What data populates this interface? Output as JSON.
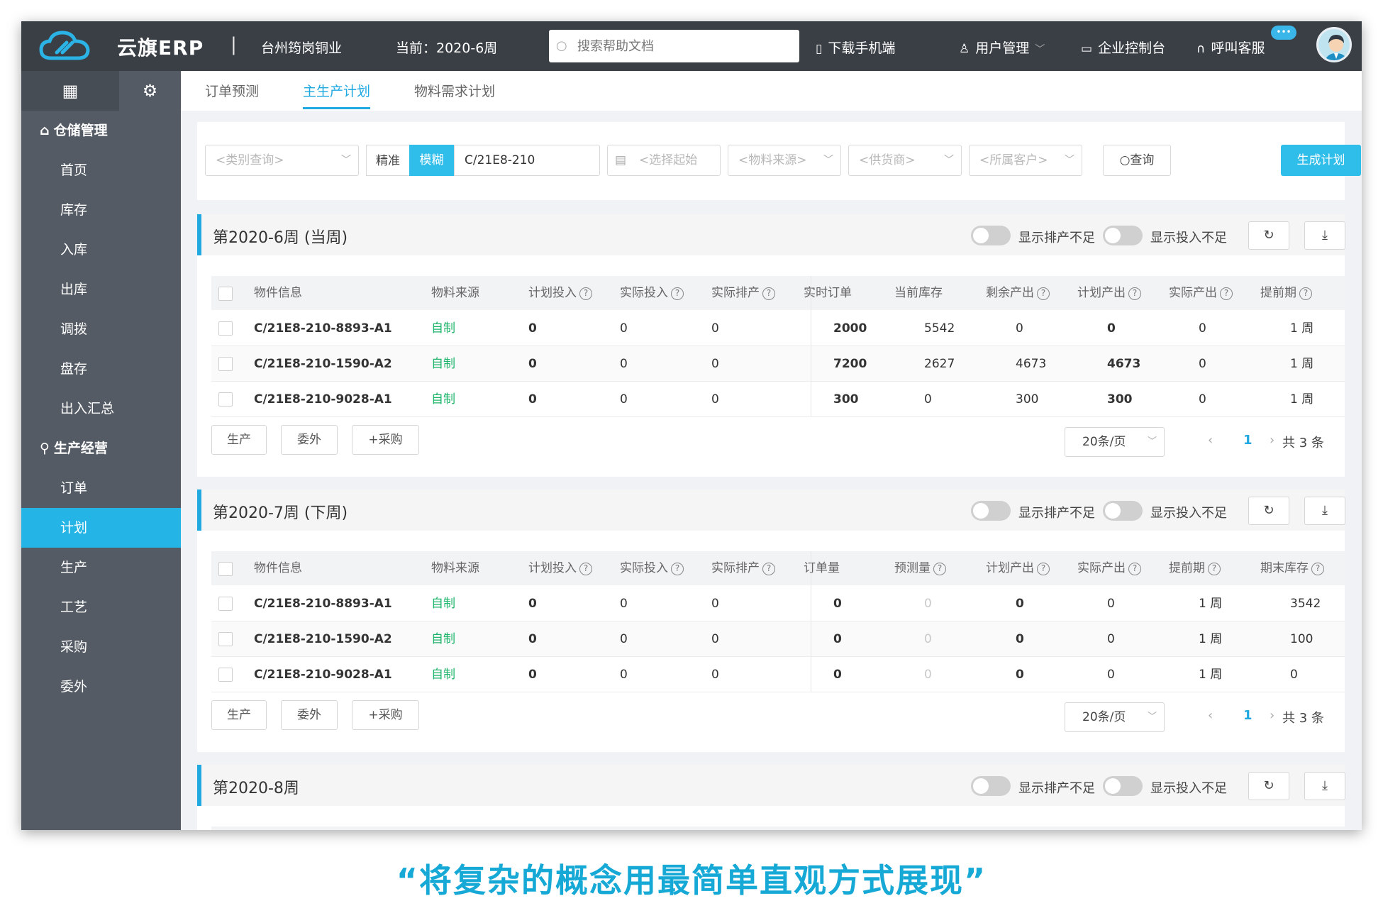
{
  "app": {
    "brand": "云旗ERP",
    "separator": "|",
    "company": "台州筠岗铜业",
    "current_period": "当前：2020-6周"
  },
  "search": {
    "placeholder": "搜索帮助文档"
  },
  "topnav": {
    "download": "下载手机端",
    "user_mgmt": "用户管理",
    "console": "企业控制台",
    "service": "呼叫客服",
    "bubble": "•••"
  },
  "sidebar": {
    "groups": [
      {
        "title": "仓储管理",
        "items": [
          "首页",
          "库存",
          "入库",
          "出库",
          "调拨",
          "盘存",
          "出入汇总"
        ]
      },
      {
        "title": "生产经营",
        "items": [
          "订单",
          "计划",
          "生产",
          "工艺",
          "采购",
          "委外"
        ]
      }
    ],
    "active": "计划"
  },
  "tabs": [
    {
      "label": "订单预测"
    },
    {
      "label": "主生产计划",
      "active": true
    },
    {
      "label": "物料需求计划"
    }
  ],
  "refresh_label": "刷新",
  "filter": {
    "category_placeholder": "<类别查询>",
    "exact_label": "精准",
    "fuzzy_label": "模糊",
    "keyword": "C/21E8-210",
    "start_placeholder": "<选择起始",
    "source_placeholder": "<物料来源>",
    "supplier_placeholder": "<供货商>",
    "customer_placeholder": "<所属客户>",
    "query_label": "查询",
    "generate_label": "生成计划"
  },
  "toggles": {
    "shortage_production": "显示排产不足",
    "shortage_input": "显示投入不足"
  },
  "actions": {
    "produce": "生产",
    "outsource": "委外",
    "purchase": "+采购"
  },
  "pagination": {
    "page_size": "20条/页",
    "current_page": "1",
    "total": "共 3 条"
  },
  "weeks": [
    {
      "title": "第2020-6周 (当周)",
      "columns": [
        "物件信息",
        "物料来源",
        "计划投入",
        "实际投入",
        "实际排产",
        "实时订单",
        "当前库存",
        "剩余产出",
        "计划产出",
        "实际产出",
        "提前期"
      ],
      "rows": [
        [
          "C/21E8-210-8893-A1",
          "自制",
          "0",
          "0",
          "0",
          "2000",
          "5542",
          "0",
          "0",
          "0",
          "1 周"
        ],
        [
          "C/21E8-210-1590-A2",
          "自制",
          "0",
          "0",
          "0",
          "7200",
          "2627",
          "4673",
          "4673",
          "0",
          "1 周"
        ],
        [
          "C/21E8-210-9028-A1",
          "自制",
          "0",
          "0",
          "0",
          "300",
          "0",
          "300",
          "300",
          "0",
          "1 周"
        ]
      ]
    },
    {
      "title": "第2020-7周 (下周)",
      "columns": [
        "物件信息",
        "物料来源",
        "计划投入",
        "实际投入",
        "实际排产",
        "订单量",
        "预测量",
        "计划产出",
        "实际产出",
        "提前期",
        "期末库存"
      ],
      "rows": [
        [
          "C/21E8-210-8893-A1",
          "自制",
          "0",
          "0",
          "0",
          "0",
          "0",
          "0",
          "0",
          "1 周",
          "3542"
        ],
        [
          "C/21E8-210-1590-A2",
          "自制",
          "0",
          "0",
          "0",
          "0",
          "0",
          "0",
          "0",
          "1 周",
          "100"
        ],
        [
          "C/21E8-210-9028-A1",
          "自制",
          "0",
          "0",
          "0",
          "0",
          "0",
          "0",
          "0",
          "1 周",
          "0"
        ]
      ]
    },
    {
      "title": "第2020-8周"
    }
  ],
  "caption": "“将复杂的概念用最简单直观方式展现”"
}
